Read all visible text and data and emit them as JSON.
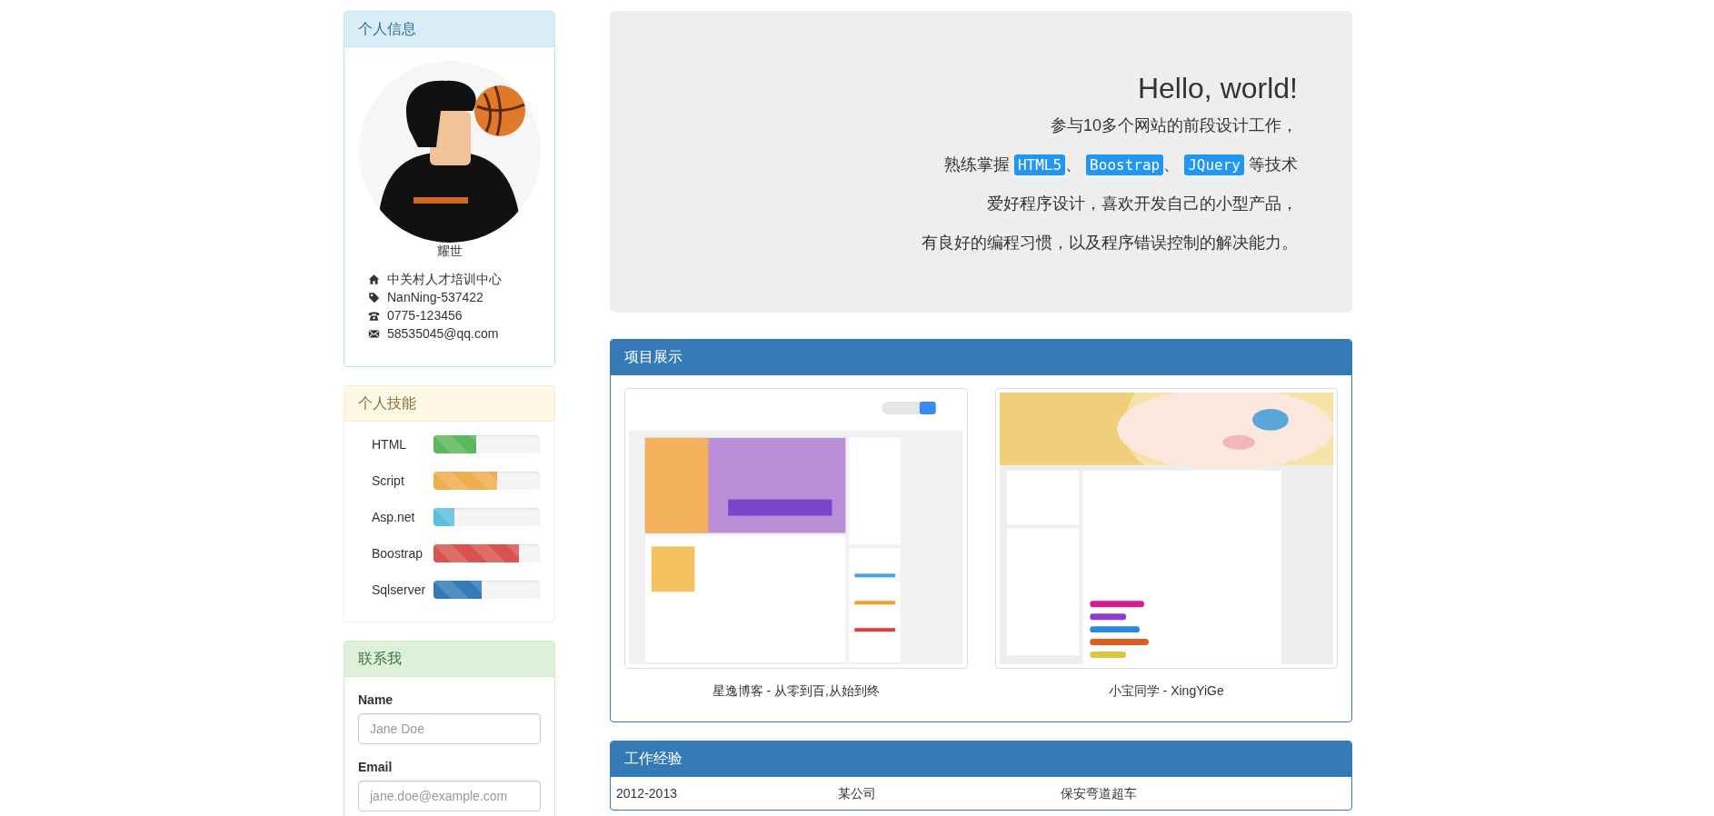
{
  "profile_panel": {
    "kind": "info",
    "title": "个人信息",
    "name": "耀世",
    "details": [
      {
        "kind": "address",
        "text": "中关村人才培训中心"
      },
      {
        "kind": "zip",
        "text": "NanNing-537422"
      },
      {
        "kind": "phone",
        "text": "0775-123456"
      },
      {
        "kind": "email",
        "text": "58535045@qq.com"
      }
    ]
  },
  "skills_panel": {
    "kind": "warning",
    "title": "个人技能",
    "skills": [
      {
        "name": "HTML",
        "level": 0.4,
        "color": "#5cb85c"
      },
      {
        "name": "Script",
        "level": 0.6,
        "color": "#f0ad4e"
      },
      {
        "name": "Asp.net",
        "level": 0.2,
        "color": "#5bc0de"
      },
      {
        "name": "Boostrap",
        "level": 0.8,
        "color": "#d9534f"
      },
      {
        "name": "Sqlserver",
        "level": 0.45,
        "color": "#337ab7"
      }
    ]
  },
  "contact_panel": {
    "kind": "success",
    "title": "联系我",
    "fields": [
      {
        "label": "Name",
        "placeholder": "Jane Doe"
      },
      {
        "label": "Email",
        "placeholder": "jane.doe@example.com"
      }
    ]
  },
  "jumbotron": {
    "heading": "Hello, world!",
    "lines": [
      {
        "kind": "text",
        "text": "参与10多个网站的前段设计工作，"
      },
      {
        "kind": "tags",
        "prefix": "熟练掌握",
        "tags": [
          "HTML5",
          "Boostrap",
          "JQuery"
        ],
        "separator": "、",
        "suffix": "等技术"
      },
      {
        "kind": "text",
        "text": "爱好程序设计，喜欢开发自己的小型产品，"
      },
      {
        "kind": "text",
        "text": "有良好的编程习惯，以及程序错误控制的解决能力。"
      }
    ]
  },
  "projects_panel": {
    "kind": "primary",
    "title": "项目展示",
    "projects": [
      {
        "caption": "星逸博客 - 从零到百,从始到终"
      },
      {
        "caption": "小宝同学 - XingYiGe"
      }
    ]
  },
  "work_panel": {
    "kind": "primary",
    "title": "工作经验",
    "rows": [
      [
        "2012-2013",
        "某公司",
        "保安弯道超车"
      ]
    ]
  }
}
